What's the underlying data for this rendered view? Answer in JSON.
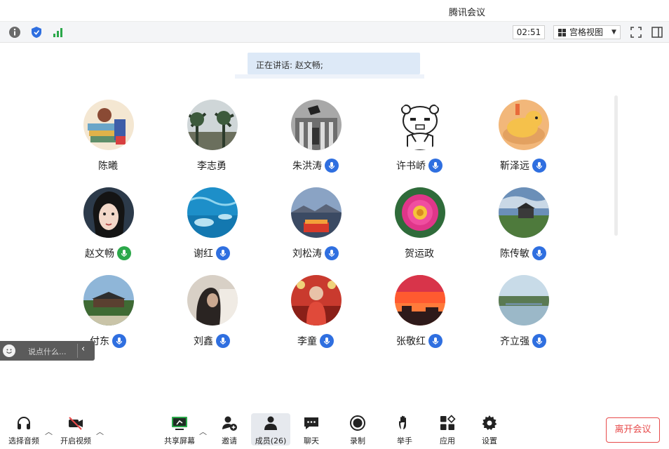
{
  "window": {
    "title": "腾讯会议"
  },
  "infobar": {
    "timer": "02:51",
    "view_mode": "宫格视图",
    "icons": [
      "info-icon",
      "shield-icon",
      "signal-icon",
      "fullscreen-icon",
      "side-panel-icon"
    ]
  },
  "speaking": {
    "text": "正在讲话: 赵文畅;"
  },
  "participants": [
    {
      "name": "陈曦",
      "mic": "none",
      "avatar": "illustration"
    },
    {
      "name": "李志勇",
      "mic": "none",
      "avatar": "palms"
    },
    {
      "name": "朱洪涛",
      "mic": "muted",
      "avatar": "building"
    },
    {
      "name": "许书峤",
      "mic": "muted",
      "avatar": "cartoon"
    },
    {
      "name": "靳泽远",
      "mic": "muted",
      "avatar": "toy"
    },
    {
      "name": "赵文畅",
      "mic": "speaking",
      "avatar": "portrait"
    },
    {
      "name": "谢红",
      "mic": "muted",
      "avatar": "ocean"
    },
    {
      "name": "刘松涛",
      "mic": "muted",
      "avatar": "sunset"
    },
    {
      "name": "贺运政",
      "mic": "none",
      "avatar": "flower"
    },
    {
      "name": "陈传敏",
      "mic": "muted",
      "avatar": "landscape"
    },
    {
      "name": "付东",
      "mic": "muted",
      "avatar": "garden"
    },
    {
      "name": "刘鑫",
      "mic": "muted",
      "avatar": "woman"
    },
    {
      "name": "李童",
      "mic": "muted",
      "avatar": "red"
    },
    {
      "name": "张敬红",
      "mic": "muted",
      "avatar": "redsky"
    },
    {
      "name": "齐立强",
      "mic": "muted",
      "avatar": "lake"
    }
  ],
  "chat": {
    "placeholder": "说点什么..."
  },
  "toolbar": {
    "audio": "选择音频",
    "video": "开启视频",
    "share": "共享屏幕",
    "invite": "邀请",
    "members": "成员(26)",
    "chat": "聊天",
    "record": "录制",
    "raise_hand": "举手",
    "apps": "应用",
    "settings": "设置",
    "leave": "离开会议"
  },
  "colors": {
    "accent": "#2f6fe0",
    "speaking": "#2ba84a",
    "danger": "#e74b4b",
    "banner": "#dde9f7"
  }
}
